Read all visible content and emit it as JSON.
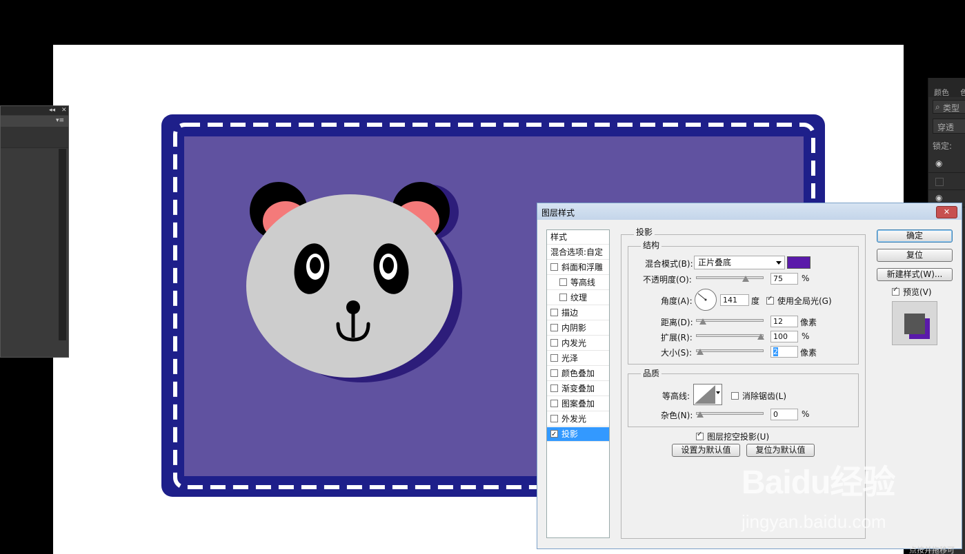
{
  "colors": {
    "card_border": "#1e1f8a",
    "card_fill": "#6052a0",
    "dash": "#ffffff",
    "panda_face": "#cdcdcd",
    "panda_shadow": "#2d1d7a",
    "panda_ear_inner": "#f47a7a",
    "shadow_color_swatch": "#5a1aaa",
    "selected_item": "#3399ff"
  },
  "right_panel": {
    "tab_color": "颜色",
    "tab_other": "色",
    "search_placeholder": "类型",
    "blend_mode": "穿透",
    "lock_label": "锁定:"
  },
  "dialog": {
    "title": "图层样式",
    "close_label": "✕",
    "styles_header": "样式",
    "blend_options": "混合选项:自定",
    "style_items": [
      {
        "label": "斜面和浮雕",
        "checked": false,
        "indent": false
      },
      {
        "label": "等高线",
        "checked": false,
        "indent": true
      },
      {
        "label": "纹理",
        "checked": false,
        "indent": true
      },
      {
        "label": "描边",
        "checked": false,
        "indent": false
      },
      {
        "label": "内阴影",
        "checked": false,
        "indent": false
      },
      {
        "label": "内发光",
        "checked": false,
        "indent": false
      },
      {
        "label": "光泽",
        "checked": false,
        "indent": false
      },
      {
        "label": "颜色叠加",
        "checked": false,
        "indent": false
      },
      {
        "label": "渐变叠加",
        "checked": false,
        "indent": false
      },
      {
        "label": "图案叠加",
        "checked": false,
        "indent": false
      },
      {
        "label": "外发光",
        "checked": false,
        "indent": false
      },
      {
        "label": "投影",
        "checked": true,
        "indent": false,
        "selected": true
      }
    ],
    "section_title": "投影",
    "structure": {
      "title": "结构",
      "blend_mode_label": "混合模式(B):",
      "blend_mode_value": "正片叠底",
      "opacity_label": "不透明度(O):",
      "opacity_value": "75",
      "opacity_level": 0.75,
      "opacity_unit": "%",
      "angle_label": "角度(A):",
      "angle_value": "141",
      "angle_unit": "度",
      "global_light_label": "使用全局光(G)",
      "global_light_checked": true,
      "distance_label": "距离(D):",
      "distance_value": "12",
      "distance_unit": "像素",
      "distance_level": 0.04,
      "spread_label": "扩展(R):",
      "spread_value": "100",
      "spread_unit": "%",
      "spread_level": 1.0,
      "size_label": "大小(S):",
      "size_value": "2",
      "size_unit": "像素",
      "size_level": 0.0
    },
    "quality": {
      "title": "品质",
      "contour_label": "等高线:",
      "antialias_label": "消除锯齿(L)",
      "antialias_checked": false,
      "noise_label": "杂色(N):",
      "noise_value": "0",
      "noise_unit": "%",
      "noise_level": 0.0
    },
    "knockout_label": "图层挖空投影(U)",
    "knockout_checked": true,
    "make_default": "设置为默认值",
    "reset_default": "复位为默认值",
    "ok": "确定",
    "reset": "复位",
    "new_style": "新建样式(W)...",
    "preview_label": "预览(V)",
    "preview_checked": true
  },
  "watermark": {
    "brand": "Baidu经验",
    "url": "jingyan.baidu.com"
  },
  "bottom_hint": "点按并拖移可"
}
